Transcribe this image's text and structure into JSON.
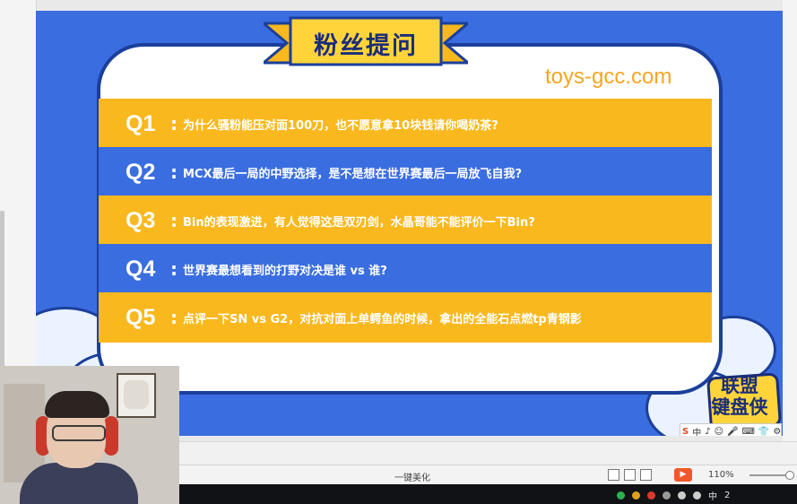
{
  "slide": {
    "title": "粉丝提问",
    "watermark": "toys-gcc.com",
    "questions": [
      {
        "label": "Q1",
        "colon": ":",
        "text": "为什么骚粉能压对面100刀，也不愿意拿10块钱请你喝奶茶?"
      },
      {
        "label": "Q2",
        "colon": ":",
        "text": "MCX最后一局的中野选择，是不是想在世界赛最后一局放飞自我?"
      },
      {
        "label": "Q3",
        "colon": ":",
        "text": "Bin的表现激进，有人觉得这是双刃剑，水晶哥能不能评价一下Bin?"
      },
      {
        "label": "Q4",
        "colon": ":",
        "text": "世界赛最想看到的打野对决是谁 vs 谁?"
      },
      {
        "label": "Q5",
        "colon": ":",
        "text": "点评一下SN vs G2，对抗对面上单鳄鱼的时候，拿出的全能石点燃tp青钢影"
      }
    ],
    "logo_text_line1": "联盟",
    "logo_text_line2": "键盘侠",
    "ime": {
      "s_glyph": "S",
      "lang": "中",
      "items": [
        "♪",
        "☺",
        "🎤",
        "⌨",
        "👕",
        "⚙"
      ]
    }
  },
  "statusbar": {
    "beautify_label": "一键美化",
    "zoom": "110%",
    "play_glyph": "▶"
  },
  "taskbar": {
    "tray": [
      "中",
      "2"
    ]
  },
  "colors": {
    "slide_blue": "#3a6de0",
    "row_yellow": "#f9b81d",
    "border_navy": "#1b3f9a",
    "watermark": "#f5a623"
  }
}
